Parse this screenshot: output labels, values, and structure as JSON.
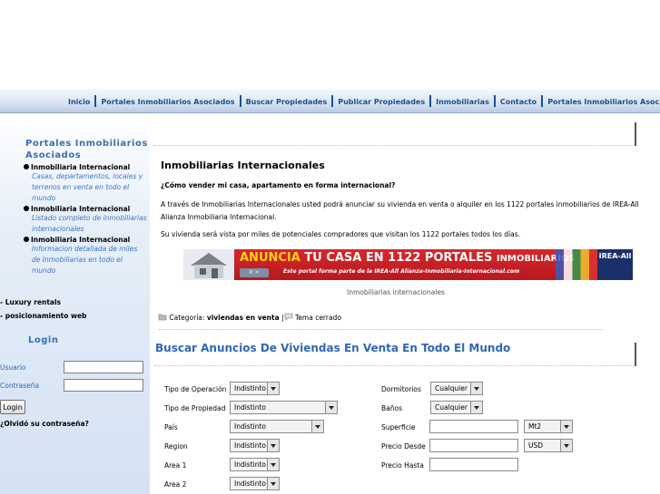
{
  "nav": {
    "items": [
      "Inicio",
      "Portales Inmobiliarios Asociados",
      "Buscar Propiedades",
      "Publicar Propiedades",
      "Inmobiliarias",
      "Contacto",
      "Portales Inmobiliarios Asociados"
    ]
  },
  "sidebar": {
    "heading_line1": "Portales Inmobiliarios",
    "heading_line2": "Asociados",
    "portals": [
      {
        "title": "Inmobiliaria Internacional",
        "desc": [
          "Casas, departamentos, locales y",
          "terrenos en venta en todo el",
          "mundo"
        ]
      },
      {
        "title": "Inmobiliaria Internacional",
        "desc": [
          "Listado completo de inmobiliarias",
          "internacionales"
        ]
      },
      {
        "title": "Inmobiliaria Internacional",
        "desc": [
          "Informacion detallada de miles",
          "de Inmobiliarias en todo el",
          "mundo"
        ]
      }
    ],
    "extra_links": [
      "- Luxury rentals",
      "- posicionamiento web"
    ],
    "login": {
      "heading": "Login",
      "user_label": "Usuario",
      "password_label": "Contraseña",
      "button_label": "Login",
      "forgot": "¿Olvidó su contraseña?"
    }
  },
  "article": {
    "title": "Inmobiliarias Internacionales",
    "question": "¿Cómo vender mi casa, apartamento en forma internacional?",
    "para1_line1": "A través de Inmobiliarias Internacionales usted podrá anunciar su vivienda en venta o alquiler en los 1122 portales inmobiliarios de IREA-All",
    "para1_line2": "Alianza Inmobiliaria Internacional.",
    "para2": "Su vivienda será vista por miles de potenciales compradores que visitan los 1122 portales todos los días.",
    "banner": {
      "main_a": "ANUNCIA",
      "main_b": "TU CASA EN 1122 PORTALES",
      "main_c": "INMOBILIARIOS",
      "sub": "Este portal forma parte de la IREA-All Alianza-Inmobiliaria-Internacional.com",
      "button": "Ir >",
      "logo": "IREA-All"
    },
    "caption": "Inmobiliarias internacionales",
    "category_label": "Categoría:",
    "category_value": "viviendas en venta",
    "separator": "|",
    "topic_status": "Tema cerrado"
  },
  "search": {
    "title": "Buscar Anuncios De Viviendas En Venta En Todo El Mundo",
    "left_fields": [
      {
        "label": "Tipo de Operación",
        "value": "Indistinto"
      },
      {
        "label": "Tipo de Propiedad",
        "value": "Indistinto"
      },
      {
        "label": "País",
        "value": "Indistinto"
      },
      {
        "label": "Region",
        "value": "Indistinto"
      },
      {
        "label": "Area 1",
        "value": "Indistinto"
      },
      {
        "label": "Area 2",
        "value": "Indistinto"
      }
    ],
    "right_fields": {
      "dormitorios_label": "Dormitorios",
      "dormitorios_value": "Cualquier",
      "banos_label": "Baños",
      "banos_value": "Cualquier",
      "superficie_label": "Superficie",
      "superficie_unit": "Mt2",
      "precio_desde_label": "Precio Desde",
      "currency": "USD",
      "precio_hasta_label": "Precio Hasta"
    }
  }
}
